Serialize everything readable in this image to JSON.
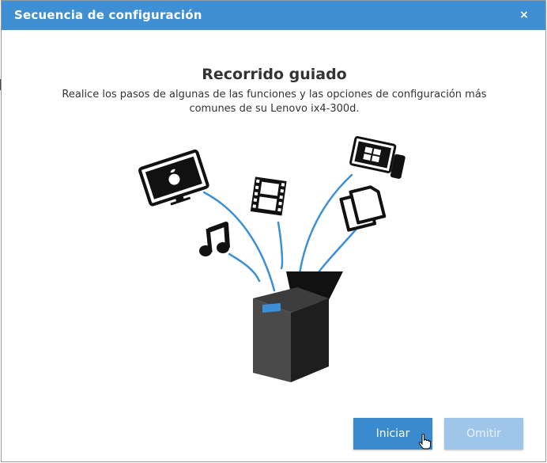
{
  "dialog": {
    "title": "Secuencia de configuración",
    "close_label": "×"
  },
  "content": {
    "heading": "Recorrido guiado",
    "description": "Realice los pasos de algunas de las funciones y las opciones de configuración más comunes de su Lenovo ix4-300d."
  },
  "buttons": {
    "start_label": "Iniciar",
    "skip_label": "Omitir"
  },
  "colors": {
    "titlebar": "#3f8fd2",
    "primary_button": "#3a8ad0",
    "disabled_button": "#9fc6e8",
    "accent_lines": "#3d8fd6",
    "device_dark": "#2b2b2b"
  },
  "icons": [
    "close-icon",
    "monitor-apple-icon",
    "film-icon",
    "music-note-icon",
    "windows-tablet-icon",
    "documents-icon",
    "storage-device-icon",
    "hand-cursor-icon"
  ]
}
